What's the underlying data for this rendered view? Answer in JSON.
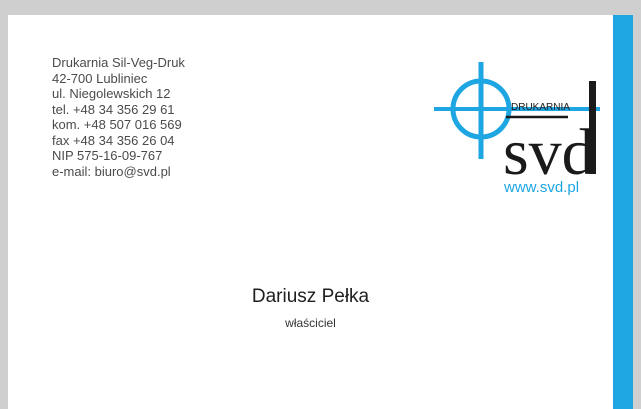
{
  "card": {
    "contact_lines": [
      "Drukarnia Sil-Veg-Druk",
      "42-700 Lubliniec",
      "ul. Niegolewskich 12",
      "tel. +48 34 356 29 61",
      "kom. +48 507 016 569",
      "fax +48 34 356 26 04",
      "NIP 575-16-09-767",
      "e-mail: biuro@svd.pl"
    ],
    "logo": {
      "brand_small": "DRUKARNIA",
      "brand_large": "svd",
      "website": "www.svd.pl"
    },
    "person": {
      "name": "Dariusz Pełka",
      "role": "właściciel"
    }
  },
  "colors": {
    "accent": "#1ea6e3",
    "text": "#4b4b4b",
    "background": "#cfcfcf",
    "card": "#ffffff"
  }
}
